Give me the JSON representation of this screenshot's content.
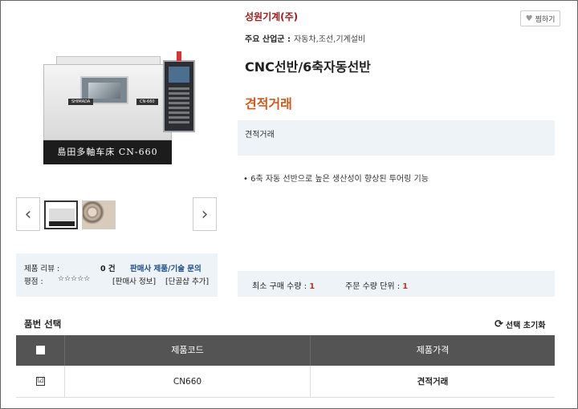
{
  "seller": {
    "name": "성원기계(주)"
  },
  "like_button": {
    "label": "찜하기"
  },
  "industry": {
    "label": "주요 산업군 :",
    "value": "자동차,조선,기계설비"
  },
  "product": {
    "title": "CNC선반/6축자동선반",
    "price": "견적거래",
    "price_note": "견적거래",
    "feature": "6축 자동 선반으로 높은 생산성이 향상된 투어링 기능",
    "machine_caption": "島田多軸车床  CN-660",
    "badge_left": "SHIMADA",
    "badge_right": "CN-660"
  },
  "gallery": {
    "prev_icon": "‹",
    "next_icon": "›"
  },
  "review": {
    "label": "제품 리뷰 :",
    "count": "0 건",
    "inquiry_link": "판매사 제품/기술 문의",
    "rating_label": "평점 :",
    "stars": "☆☆☆☆☆",
    "seller_info_link": "[판매사 정보]",
    "bookmark_link": "[단골샵 추가]"
  },
  "quantity": {
    "min_label": "최소 구매 수량 :",
    "min_value": "1",
    "unit_label": "주문 수량 단위 :",
    "unit_value": "1"
  },
  "options": {
    "title": "품번 선택",
    "reset_label": "선택 초기화",
    "columns": [
      "제품코드",
      "제품가격"
    ],
    "rows": [
      {
        "code": "CN660",
        "price": "견적거래",
        "checked": "☑"
      }
    ]
  }
}
